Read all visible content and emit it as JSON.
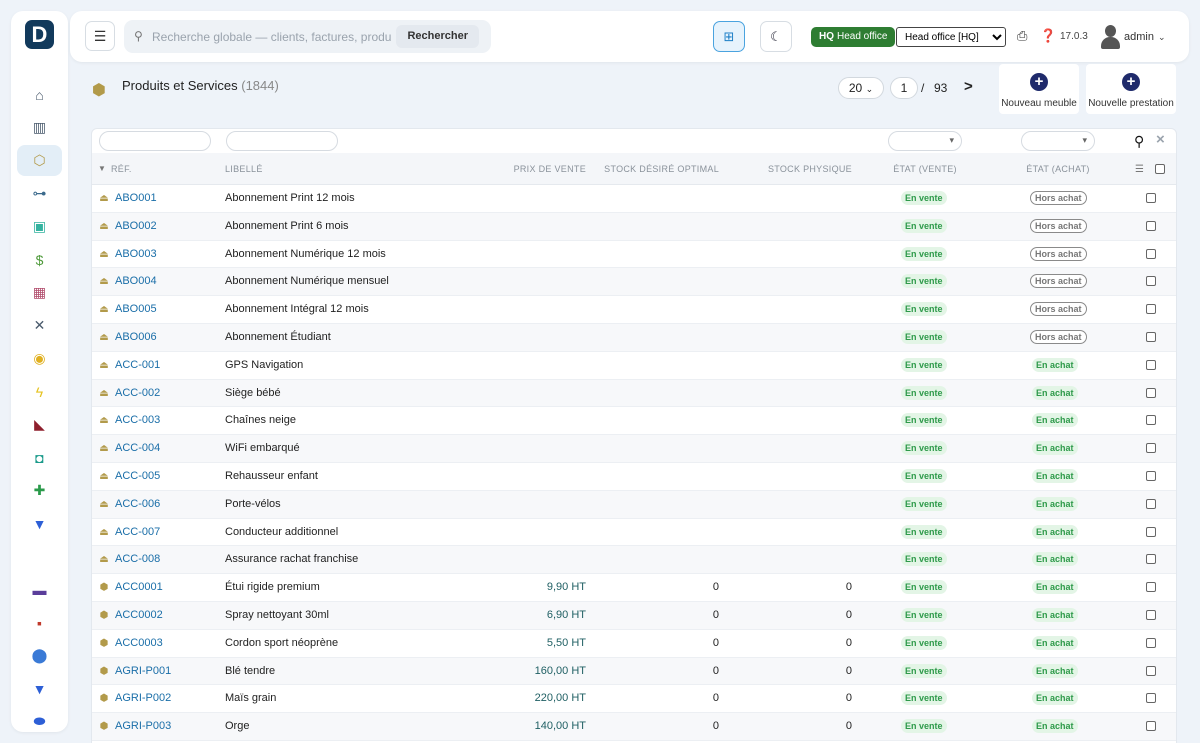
{
  "app": {
    "logo_letter": "D",
    "version": "17.0.3",
    "user_name": "admin"
  },
  "search": {
    "placeholder": "Recherche globale — clients, factures, produits...",
    "button_label": "Rechercher"
  },
  "entity": {
    "badge_code": "HQ",
    "badge_label": "Head office",
    "selected": "Head office [HQ]"
  },
  "sidebar": {
    "items": [
      {
        "icon": "home-icon",
        "glyph": "⌂",
        "color": "#4a5b6d"
      },
      {
        "icon": "building-icon",
        "glyph": "▥",
        "color": "#4a5b6d"
      },
      {
        "icon": "box-icon",
        "glyph": "⬡",
        "color": "#b29a4a",
        "active": true
      },
      {
        "icon": "network-icon",
        "glyph": "⊶",
        "color": "#3b6a8c"
      },
      {
        "icon": "briefcase-icon",
        "glyph": "▣",
        "color": "#34b3a0"
      },
      {
        "icon": "invoice-icon",
        "glyph": "$",
        "color": "#4f9a3b"
      },
      {
        "icon": "calendar-icon",
        "glyph": "▦",
        "color": "#b04a6a"
      },
      {
        "icon": "tools-icon",
        "glyph": "✕",
        "color": "#4a5b6d"
      },
      {
        "icon": "eye-icon",
        "glyph": "◉",
        "color": "#e0b020"
      },
      {
        "icon": "bolt-icon",
        "glyph": "ϟ",
        "color": "#e6c320"
      },
      {
        "icon": "flag-icon",
        "glyph": "◣",
        "color": "#8e1f2d"
      },
      {
        "icon": "shield-icon",
        "glyph": "◘",
        "color": "#1a9a8a"
      },
      {
        "icon": "plus-icon",
        "glyph": "✚",
        "color": "#2a9a4a"
      },
      {
        "icon": "filter-icon",
        "glyph": "▼",
        "color": "#2d5fd6"
      },
      {
        "icon": "layers-icon",
        "glyph": "▬",
        "color": "#5a3d9a"
      },
      {
        "icon": "gift-icon",
        "glyph": "▪",
        "color": "#c0392b"
      },
      {
        "icon": "pin-icon",
        "glyph": "⬤",
        "color": "#3a7ad6"
      },
      {
        "icon": "filter-icon-2",
        "glyph": "▼",
        "color": "#2d5fd6"
      },
      {
        "icon": "disc-icon",
        "glyph": "⬬",
        "color": "#2d5fd6"
      }
    ]
  },
  "page": {
    "title": "Produits et Services",
    "count": "(1844)"
  },
  "pager": {
    "page_size": "20",
    "current_page": "1",
    "separator": "/",
    "total_pages": "93"
  },
  "actions": {
    "new_furniture": "Nouveau meuble",
    "new_service": "Nouvelle prestation"
  },
  "table": {
    "columns": {
      "ref": "RÉF.",
      "label": "LIBELLÉ",
      "price": "PRIX DE VENTE",
      "stock_opt": "STOCK DÉSIRÉ OPTIMAL",
      "stock_phys": "STOCK PHYSIQUE",
      "state_sell": "ÉTAT (VENTE)",
      "state_buy": "ÉTAT (ACHAT)"
    },
    "rows": [
      {
        "type": "service",
        "ref": "ABO001",
        "label": "Abonnement Print 12 mois",
        "price": "",
        "stock_opt": "",
        "stock_phys": "",
        "sell": "En vente",
        "buy": "Hors achat",
        "buy_on": false
      },
      {
        "type": "service",
        "ref": "ABO002",
        "label": "Abonnement Print 6 mois",
        "price": "",
        "stock_opt": "",
        "stock_phys": "",
        "sell": "En vente",
        "buy": "Hors achat",
        "buy_on": false
      },
      {
        "type": "service",
        "ref": "ABO003",
        "label": "Abonnement Numérique 12 mois",
        "price": "",
        "stock_opt": "",
        "stock_phys": "",
        "sell": "En vente",
        "buy": "Hors achat",
        "buy_on": false
      },
      {
        "type": "service",
        "ref": "ABO004",
        "label": "Abonnement Numérique mensuel",
        "price": "",
        "stock_opt": "",
        "stock_phys": "",
        "sell": "En vente",
        "buy": "Hors achat",
        "buy_on": false
      },
      {
        "type": "service",
        "ref": "ABO005",
        "label": "Abonnement Intégral 12 mois",
        "price": "",
        "stock_opt": "",
        "stock_phys": "",
        "sell": "En vente",
        "buy": "Hors achat",
        "buy_on": false
      },
      {
        "type": "service",
        "ref": "ABO006",
        "label": "Abonnement Étudiant",
        "price": "",
        "stock_opt": "",
        "stock_phys": "",
        "sell": "En vente",
        "buy": "Hors achat",
        "buy_on": false
      },
      {
        "type": "service",
        "ref": "ACC-001",
        "label": "GPS Navigation",
        "price": "",
        "stock_opt": "",
        "stock_phys": "",
        "sell": "En vente",
        "buy": "En achat",
        "buy_on": true
      },
      {
        "type": "service",
        "ref": "ACC-002",
        "label": "Siège bébé",
        "price": "",
        "stock_opt": "",
        "stock_phys": "",
        "sell": "En vente",
        "buy": "En achat",
        "buy_on": true
      },
      {
        "type": "service",
        "ref": "ACC-003",
        "label": "Chaînes neige",
        "price": "",
        "stock_opt": "",
        "stock_phys": "",
        "sell": "En vente",
        "buy": "En achat",
        "buy_on": true
      },
      {
        "type": "service",
        "ref": "ACC-004",
        "label": "WiFi embarqué",
        "price": "",
        "stock_opt": "",
        "stock_phys": "",
        "sell": "En vente",
        "buy": "En achat",
        "buy_on": true
      },
      {
        "type": "service",
        "ref": "ACC-005",
        "label": "Rehausseur enfant",
        "price": "",
        "stock_opt": "",
        "stock_phys": "",
        "sell": "En vente",
        "buy": "En achat",
        "buy_on": true
      },
      {
        "type": "service",
        "ref": "ACC-006",
        "label": "Porte-vélos",
        "price": "",
        "stock_opt": "",
        "stock_phys": "",
        "sell": "En vente",
        "buy": "En achat",
        "buy_on": true
      },
      {
        "type": "service",
        "ref": "ACC-007",
        "label": "Conducteur additionnel",
        "price": "",
        "stock_opt": "",
        "stock_phys": "",
        "sell": "En vente",
        "buy": "En achat",
        "buy_on": true
      },
      {
        "type": "service",
        "ref": "ACC-008",
        "label": "Assurance rachat franchise",
        "price": "",
        "stock_opt": "",
        "stock_phys": "",
        "sell": "En vente",
        "buy": "En achat",
        "buy_on": true
      },
      {
        "type": "product",
        "ref": "ACC0001",
        "label": "Étui rigide premium",
        "price": "9,90 HT",
        "stock_opt": "0",
        "stock_phys": "0",
        "sell": "En vente",
        "buy": "En achat",
        "buy_on": true
      },
      {
        "type": "product",
        "ref": "ACC0002",
        "label": "Spray nettoyant 30ml",
        "price": "6,90 HT",
        "stock_opt": "0",
        "stock_phys": "0",
        "sell": "En vente",
        "buy": "En achat",
        "buy_on": true
      },
      {
        "type": "product",
        "ref": "ACC0003",
        "label": "Cordon sport néoprène",
        "price": "5,50 HT",
        "stock_opt": "0",
        "stock_phys": "0",
        "sell": "En vente",
        "buy": "En achat",
        "buy_on": true
      },
      {
        "type": "product",
        "ref": "AGRI-P001",
        "label": "Blé tendre",
        "price": "160,00 HT",
        "stock_opt": "0",
        "stock_phys": "0",
        "sell": "En vente",
        "buy": "En achat",
        "buy_on": true
      },
      {
        "type": "product",
        "ref": "AGRI-P002",
        "label": "Maïs grain",
        "price": "220,00 HT",
        "stock_opt": "0",
        "stock_phys": "0",
        "sell": "En vente",
        "buy": "En achat",
        "buy_on": true
      },
      {
        "type": "product",
        "ref": "AGRI-P003",
        "label": "Orge",
        "price": "140,00 HT",
        "stock_opt": "0",
        "stock_phys": "0",
        "sell": "En vente",
        "buy": "En achat",
        "buy_on": true
      }
    ]
  }
}
